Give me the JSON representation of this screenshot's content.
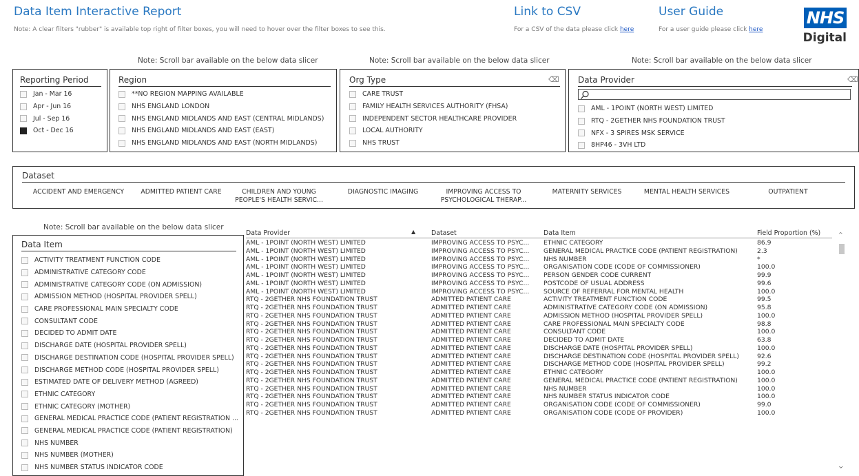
{
  "header": {
    "title": "Data Item Interactive Report",
    "note": "Note: A clear filters \"rubber\" is available top right of filter boxes, you will need to hover over the filter boxes to see this.",
    "csv_title": "Link to CSV",
    "csv_note": "For a CSV of the data please click",
    "csv_link": "here",
    "guide_title": "User Guide",
    "guide_note": "For a user guide please click",
    "guide_link": "here",
    "logo_top": "NHS",
    "logo_bottom": "Digital",
    "brand_color": "#005eb8"
  },
  "slicer_note": "Note: Scroll bar available on the below data slicer",
  "reporting_period": {
    "title": "Reporting Period",
    "items": [
      {
        "label": "Jan - Mar 16",
        "checked": false
      },
      {
        "label": "Apr - Jun 16",
        "checked": false
      },
      {
        "label": "Jul - Sep 16",
        "checked": false
      },
      {
        "label": "Oct - Dec 16",
        "checked": true
      }
    ]
  },
  "region": {
    "title": "Region",
    "items": [
      "**NO REGION MAPPING AVAILABLE",
      "NHS ENGLAND LONDON",
      "NHS ENGLAND MIDLANDS AND EAST (CENTRAL MIDLANDS)",
      "NHS ENGLAND MIDLANDS AND EAST (EAST)",
      "NHS ENGLAND MIDLANDS AND EAST (NORTH MIDLANDS)"
    ]
  },
  "org_type": {
    "title": "Org Type",
    "items": [
      "CARE TRUST",
      "FAMILY HEALTH SERVICES AUTHORITY (FHSA)",
      "INDEPENDENT SECTOR HEALTHCARE PROVIDER",
      "LOCAL AUTHORITY",
      "NHS TRUST"
    ]
  },
  "data_provider": {
    "title": "Data Provider",
    "search_placeholder": "",
    "items": [
      "AML - 1POINT (NORTH WEST) LIMITED",
      "RTQ - 2GETHER NHS FOUNDATION TRUST",
      "NFX - 3 SPIRES MSK SERVICE",
      "8HP46 - 3VH LTD"
    ]
  },
  "dataset": {
    "title": "Dataset",
    "items": [
      "ACCIDENT AND EMERGENCY",
      "ADMITTED PATIENT CARE",
      "CHILDREN AND YOUNG PEOPLE'S HEALTH SERVIC...",
      "DIAGNOSTIC IMAGING",
      "IMPROVING ACCESS TO PSYCHOLOGICAL THERAP...",
      "MATERNITY SERVICES",
      "MENTAL HEALTH SERVICES",
      "OUTPATIENT"
    ]
  },
  "data_item_slicer": {
    "title": "Data Item",
    "items": [
      "ACTIVITY TREATMENT FUNCTION CODE",
      "ADMINISTRATIVE CATEGORY CODE",
      "ADMINISTRATIVE CATEGORY CODE (ON ADMISSION)",
      "ADMISSION METHOD (HOSPITAL PROVIDER SPELL)",
      "CARE PROFESSIONAL MAIN SPECIALTY CODE",
      "CONSULTANT CODE",
      "DECIDED TO ADMIT DATE",
      "DISCHARGE DATE (HOSPITAL PROVIDER SPELL)",
      "DISCHARGE DESTINATION CODE (HOSPITAL PROVIDER SPELL)",
      "DISCHARGE METHOD CODE (HOSPITAL PROVIDER SPELL)",
      "ESTIMATED DATE OF DELIVERY METHOD (AGREED)",
      "ETHNIC CATEGORY",
      "ETHNIC CATEGORY (MOTHER)",
      "GENERAL MEDICAL PRACTICE CODE (PATIENT REGISTRATION ...",
      "GENERAL MEDICAL PRACTICE CODE (PATIENT REGISTRATION)",
      "NHS NUMBER",
      "NHS NUMBER (MOTHER)",
      "NHS NUMBER STATUS INDICATOR CODE"
    ]
  },
  "table": {
    "columns": [
      "Data Provider",
      "Dataset",
      "Data Item",
      "Field Proportion (%)"
    ],
    "sort_indicator": "▲",
    "rows": [
      [
        "AML - 1POINT (NORTH WEST) LIMITED",
        "IMPROVING ACCESS TO PSYC...",
        "ETHNIC CATEGORY",
        "86.9"
      ],
      [
        "AML - 1POINT (NORTH WEST) LIMITED",
        "IMPROVING ACCESS TO PSYC...",
        "GENERAL MEDICAL PRACTICE CODE (PATIENT REGISTRATION)",
        "2.3"
      ],
      [
        "AML - 1POINT (NORTH WEST) LIMITED",
        "IMPROVING ACCESS TO PSYC...",
        "NHS NUMBER",
        "*"
      ],
      [
        "AML - 1POINT (NORTH WEST) LIMITED",
        "IMPROVING ACCESS TO PSYC...",
        "ORGANISATION CODE (CODE OF COMMISSIONER)",
        "100.0"
      ],
      [
        "AML - 1POINT (NORTH WEST) LIMITED",
        "IMPROVING ACCESS TO PSYC...",
        "PERSON GENDER CODE CURRENT",
        "99.9"
      ],
      [
        "AML - 1POINT (NORTH WEST) LIMITED",
        "IMPROVING ACCESS TO PSYC...",
        "POSTCODE OF USUAL ADDRESS",
        "99.6"
      ],
      [
        "AML - 1POINT (NORTH WEST) LIMITED",
        "IMPROVING ACCESS TO PSYC...",
        "SOURCE OF REFERRAL FOR MENTAL HEALTH",
        "100.0"
      ],
      [
        "RTQ - 2GETHER NHS FOUNDATION TRUST",
        "ADMITTED PATIENT CARE",
        "ACTIVITY TREATMENT FUNCTION CODE",
        "99.5"
      ],
      [
        "RTQ - 2GETHER NHS FOUNDATION TRUST",
        "ADMITTED PATIENT CARE",
        "ADMINISTRATIVE CATEGORY CODE (ON ADMISSION)",
        "95.8"
      ],
      [
        "RTQ - 2GETHER NHS FOUNDATION TRUST",
        "ADMITTED PATIENT CARE",
        "ADMISSION METHOD (HOSPITAL PROVIDER SPELL)",
        "100.0"
      ],
      [
        "RTQ - 2GETHER NHS FOUNDATION TRUST",
        "ADMITTED PATIENT CARE",
        "CARE PROFESSIONAL MAIN SPECIALTY CODE",
        "98.8"
      ],
      [
        "RTQ - 2GETHER NHS FOUNDATION TRUST",
        "ADMITTED PATIENT CARE",
        "CONSULTANT CODE",
        "100.0"
      ],
      [
        "RTQ - 2GETHER NHS FOUNDATION TRUST",
        "ADMITTED PATIENT CARE",
        "DECIDED TO ADMIT DATE",
        "63.8"
      ],
      [
        "RTQ - 2GETHER NHS FOUNDATION TRUST",
        "ADMITTED PATIENT CARE",
        "DISCHARGE DATE (HOSPITAL PROVIDER SPELL)",
        "100.0"
      ],
      [
        "RTQ - 2GETHER NHS FOUNDATION TRUST",
        "ADMITTED PATIENT CARE",
        "DISCHARGE DESTINATION CODE (HOSPITAL PROVIDER SPELL)",
        "92.6"
      ],
      [
        "RTQ - 2GETHER NHS FOUNDATION TRUST",
        "ADMITTED PATIENT CARE",
        "DISCHARGE METHOD CODE (HOSPITAL PROVIDER SPELL)",
        "99.2"
      ],
      [
        "RTQ - 2GETHER NHS FOUNDATION TRUST",
        "ADMITTED PATIENT CARE",
        "ETHNIC CATEGORY",
        "100.0"
      ],
      [
        "RTQ - 2GETHER NHS FOUNDATION TRUST",
        "ADMITTED PATIENT CARE",
        "GENERAL MEDICAL PRACTICE CODE (PATIENT REGISTRATION)",
        "100.0"
      ],
      [
        "RTQ - 2GETHER NHS FOUNDATION TRUST",
        "ADMITTED PATIENT CARE",
        "NHS NUMBER",
        "100.0"
      ],
      [
        "RTQ - 2GETHER NHS FOUNDATION TRUST",
        "ADMITTED PATIENT CARE",
        "NHS NUMBER STATUS INDICATOR CODE",
        "100.0"
      ],
      [
        "RTQ - 2GETHER NHS FOUNDATION TRUST",
        "ADMITTED PATIENT CARE",
        "ORGANISATION CODE (CODE OF COMMISSIONER)",
        "99.0"
      ],
      [
        "RTQ - 2GETHER NHS FOUNDATION TRUST",
        "ADMITTED PATIENT CARE",
        "ORGANISATION CODE (CODE OF PROVIDER)",
        "100.0"
      ]
    ]
  }
}
